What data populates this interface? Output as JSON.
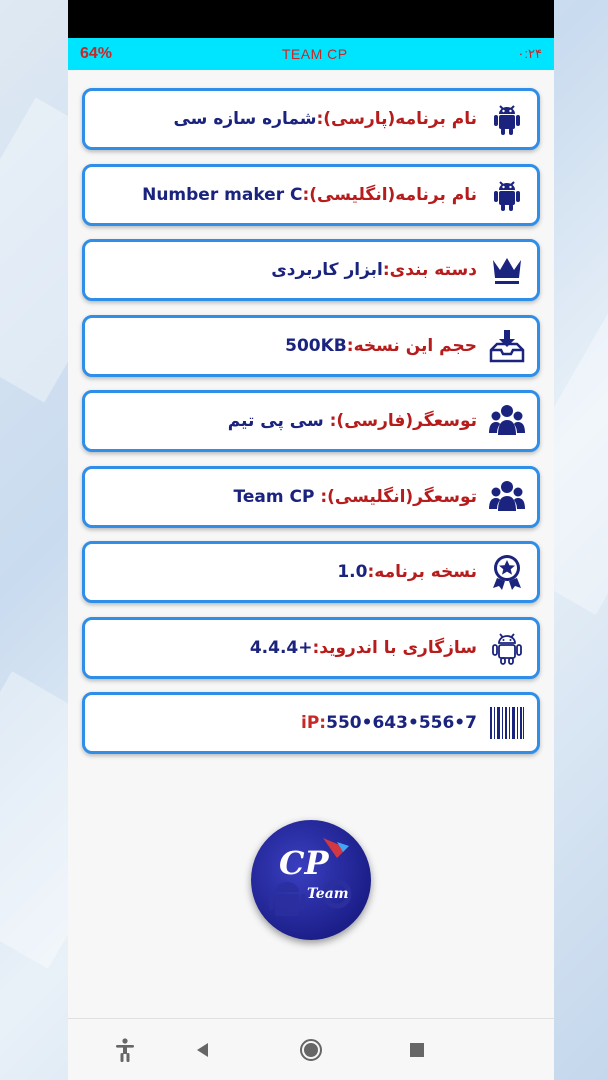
{
  "statusbar": {
    "battery": "64%",
    "title": "TEAM CP",
    "time": "۰:۲۴"
  },
  "items": [
    {
      "label": "نام برنامه(پارسی):",
      "value": "شماره سازه سی",
      "icon": "android-icon"
    },
    {
      "label": "نام برنامه(انگلیسی):",
      "value": "Number maker C",
      "icon": "android-icon"
    },
    {
      "label": "دسته بندی:",
      "value": "ابزار کاربردی",
      "icon": "crown-icon"
    },
    {
      "label": "حجم این نسخه:",
      "value": "500KB",
      "icon": "download-tray-icon"
    },
    {
      "label": "توسعگر(فارسی):",
      "value": " سی پی تیم",
      "icon": "group-icon"
    },
    {
      "label": "توسعگر(انگلیسی):",
      "value": "  Team CP",
      "icon": "group-icon"
    },
    {
      "label": "نسخه برنامه:",
      "value": "1.0",
      "icon": "award-badge-icon"
    },
    {
      "label": "سازگاری با اندروید:",
      "value": "+4.4.4",
      "icon": "android-outline-icon"
    },
    {
      "label": "iP:",
      "value": "550•643•556•7",
      "icon": "barcode-icon"
    }
  ],
  "logo": {
    "text_main": "CP",
    "text_sub": "Team"
  },
  "colors": {
    "statusbar_bg": "#00e5ff",
    "card_border": "#2f8ee8",
    "label": "#b71c1c",
    "value": "#1a237e",
    "icon": "#1a237e"
  }
}
